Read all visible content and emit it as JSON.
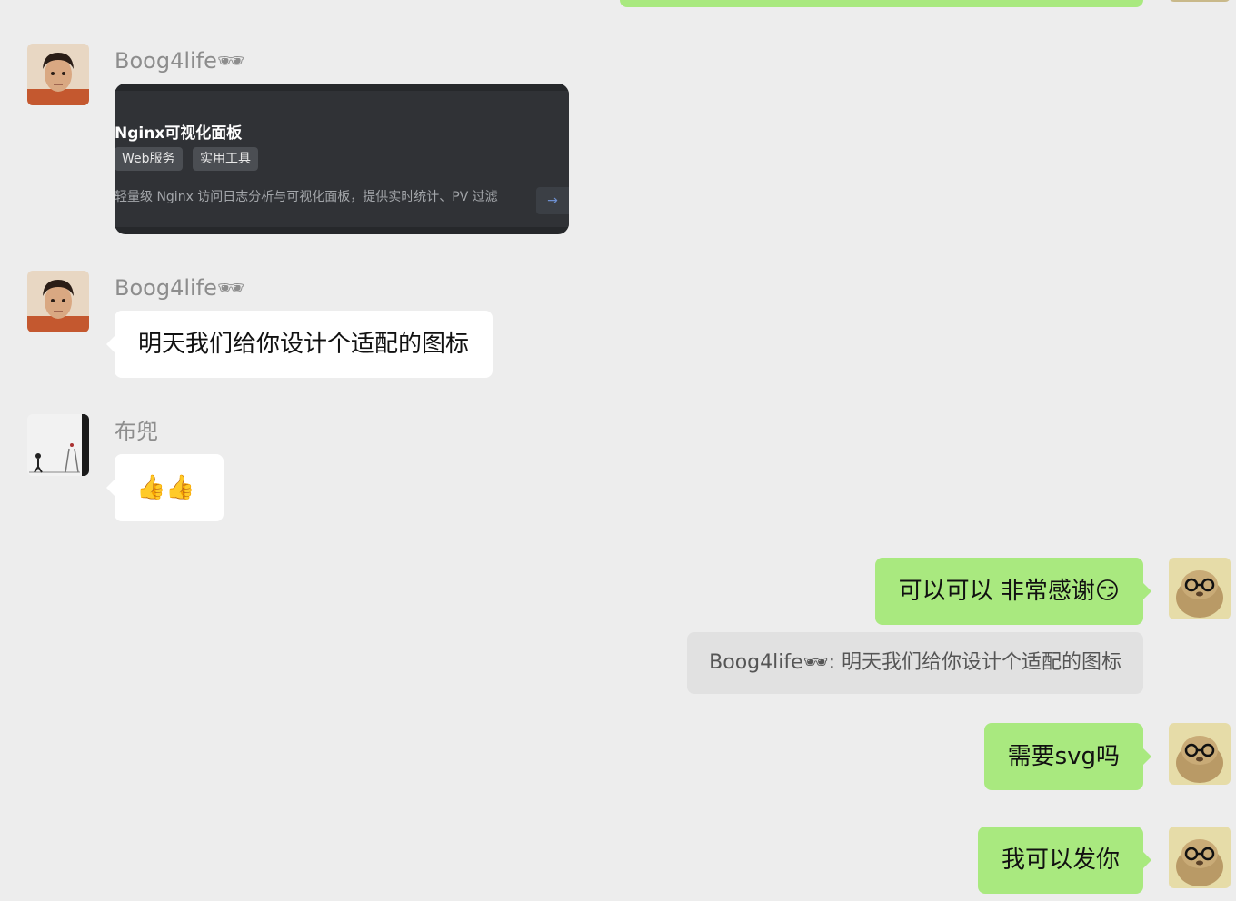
{
  "senders": {
    "boog": "Boog4life🕶",
    "bu": "布兜"
  },
  "card": {
    "title": "Nginx可视化面板",
    "tags": [
      "Web服务",
      "实用工具"
    ],
    "description": "轻量级 Nginx 访问日志分析与可视化面板，提供实时统计、PV 过滤",
    "action_icon": "→"
  },
  "messages": {
    "boog_design": "明天我们给你设计个适配的图标",
    "bu_thumbs": "👍👍",
    "me_thanks": "可以可以 非常感谢😏",
    "quote": "Boog4life🕶: 明天我们给你设计个适配的图标",
    "me_svg": "需要svg吗",
    "me_send": "我可以发你"
  },
  "colors": {
    "background": "#ededed",
    "bubble_in": "#ffffff",
    "bubble_out": "#a9e97f",
    "card_bg": "#303236"
  }
}
